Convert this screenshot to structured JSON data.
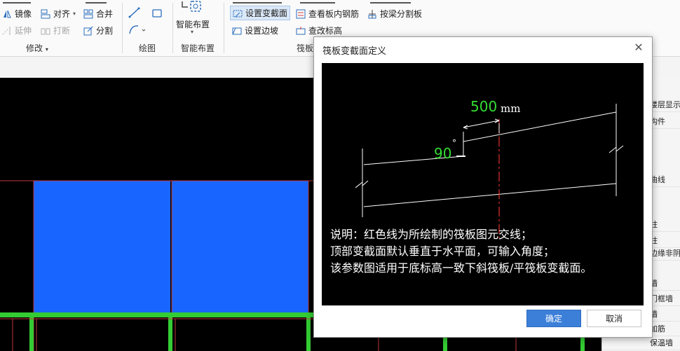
{
  "ribbon": {
    "modify": {
      "mirror": "镜像",
      "align": "对齐",
      "merge": "合并",
      "extend": "延伸",
      "break": "打断",
      "split": "分割",
      "group_label": "修改"
    },
    "draw": {
      "group_label": "绘图"
    },
    "smart": {
      "button": "智能布置",
      "group_label": "智能布置"
    },
    "raft": {
      "set_section": "设置变截面",
      "view_rebar": "查看板内钢筋",
      "split_by_beam": "按梁分割板",
      "set_edge_slope": "设置边坡",
      "check_elevation": "查改标高",
      "group_label": "筏板"
    }
  },
  "right_panel": {
    "rows": [
      "楼层显示",
      "构件",
      "曲线",
      "柱",
      "柱",
      "边缘非阴",
      "墙",
      "门框墙",
      "墙",
      "加筋",
      "保温墙"
    ]
  },
  "dialog": {
    "title": "筏板变截面定义",
    "close_icon": "close-icon",
    "figure": {
      "dim_value": "500",
      "dim_unit": "mm",
      "angle_value": "90",
      "angle_unit": "°",
      "dim_color": "#33dd33"
    },
    "description": [
      "说明：红色线为所绘制的筏板图元交线；",
      "顶部变截面默认垂直于水平面，可输入角度；",
      "该参数图适用于底标高一致下斜筏板/平筏板变截面。"
    ],
    "ok_label": "确定",
    "cancel_label": "取消"
  },
  "colors": {
    "slab_fill": "#1866ff",
    "slab_border": "#c0393b",
    "beam_green": "#33cc33",
    "accent": "#3b7fd9"
  }
}
